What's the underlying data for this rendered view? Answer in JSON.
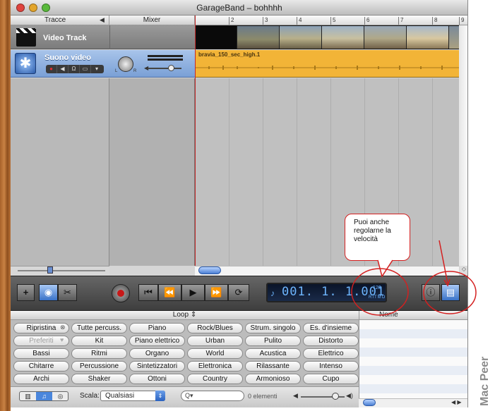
{
  "window": {
    "title": "GarageBand – bohhhh"
  },
  "headers": {
    "tracks": "Tracce",
    "mixer": "Mixer"
  },
  "ruler": {
    "ticks": [
      "2",
      "3",
      "4",
      "5",
      "6",
      "7",
      "8",
      "9"
    ]
  },
  "video_track": {
    "name": "Video Track"
  },
  "audio_track": {
    "name": "Suono video",
    "region_name": "bravia_150_sec_high.1"
  },
  "lcd": {
    "time": "001. 1. 1.001",
    "tempo": "120",
    "tempo_label": "RITMO"
  },
  "loop_browser": {
    "header": "Loop ⇕",
    "results_header": "Nome",
    "keyword_rows": [
      [
        "Ripristina",
        "Tutte percuss.",
        "Piano",
        "Rock/Blues",
        "Strum. singolo",
        "Es. d'insieme"
      ],
      [
        "Preferiti",
        "Kit",
        "Piano elettrico",
        "Urban",
        "Pulito",
        "Distorto"
      ],
      [
        "Bassi",
        "Ritmi",
        "Organo",
        "World",
        "Acustica",
        "Elettrico"
      ],
      [
        "Chitarre",
        "Percussione",
        "Sintetizzatori",
        "Elettronica",
        "Rilassante",
        "Intenso"
      ],
      [
        "Archi",
        "Shaker",
        "Ottoni",
        "Country",
        "Armonioso",
        "Cupo"
      ]
    ],
    "scale_label": "Scala:",
    "scale_value": "Qualsiasi",
    "search_placeholder": "Q▾",
    "count": "0 elementi"
  },
  "annotation": {
    "text": "Puoi anche regolarne la velocità",
    "color": "#d42020"
  },
  "watermark": "Mac Peer",
  "colors": {
    "region": "#f2b437",
    "lcd_text": "#6eb6ff",
    "selected_track": "#8fb0e0",
    "playhead": "#c32b2b"
  }
}
